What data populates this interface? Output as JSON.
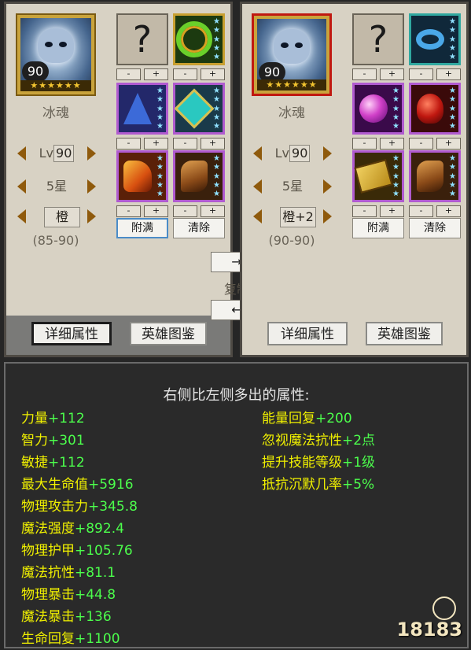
{
  "left": {
    "portrait": {
      "level": "90",
      "stars": "★★★★★★",
      "icon": "ice-soul-hero-icon"
    },
    "name": "冰魂",
    "level": {
      "prefix": "Lv",
      "value": "90"
    },
    "star_rank": "5星",
    "quality": "橙",
    "range": "(85-90)",
    "slots": [
      {
        "type": "empty",
        "icon": "question-mark-icon",
        "glyph": "?"
      },
      {
        "type": "item",
        "icon": "green-ring-icon"
      },
      {
        "type": "item",
        "icon": "wizard-hat-icon"
      },
      {
        "type": "item",
        "icon": "teal-amulet-icon"
      },
      {
        "type": "item",
        "icon": "fire-gauntlet-icon"
      },
      {
        "type": "item",
        "icon": "leather-boots-icon"
      }
    ],
    "fill_label": "附满",
    "clear_label": "清除",
    "detail_label": "详细属性",
    "codex_label": "英雄图鉴"
  },
  "right": {
    "portrait": {
      "level": "90",
      "stars": "★★★★★★",
      "icon": "ice-soul-hero-icon"
    },
    "name": "冰魂",
    "level": {
      "prefix": "Lv",
      "value": "90"
    },
    "star_rank": "5星",
    "quality": "橙+2",
    "range": "(90-90)",
    "slots": [
      {
        "type": "empty",
        "icon": "question-mark-icon",
        "glyph": "?"
      },
      {
        "type": "item",
        "icon": "blue-bracelet-icon"
      },
      {
        "type": "item",
        "icon": "magic-orb-icon"
      },
      {
        "type": "item",
        "icon": "red-beetle-icon"
      },
      {
        "type": "item",
        "icon": "spellbook-icon"
      },
      {
        "type": "item",
        "icon": "leather-boots-icon"
      }
    ],
    "fill_label": "附满",
    "clear_label": "清除",
    "detail_label": "详细属性",
    "codex_label": "英雄图鉴"
  },
  "stepper": {
    "minus": "-",
    "plus": "+"
  },
  "copy": {
    "right_arrow": "→",
    "label": "复制",
    "left_arrow": "←"
  },
  "diff": {
    "title": "右侧比左侧多出的属性:",
    "left_col": [
      {
        "name": "力量",
        "value": "+112"
      },
      {
        "name": "智力",
        "value": "+301"
      },
      {
        "name": "敏捷",
        "value": "+112"
      },
      {
        "name": "最大生命值",
        "value": "+5916"
      },
      {
        "name": "物理攻击力",
        "value": "+345.8"
      },
      {
        "name": "魔法强度",
        "value": "+892.4"
      },
      {
        "name": "物理护甲",
        "value": "+105.76"
      },
      {
        "name": "魔法抗性",
        "value": "+81.1"
      },
      {
        "name": "物理暴击",
        "value": "+44.8"
      },
      {
        "name": "魔法暴击",
        "value": "+136"
      },
      {
        "name": "生命回复",
        "value": "+1100"
      }
    ],
    "right_col": [
      {
        "name": "能量回复",
        "value": "+200"
      },
      {
        "name": "忽视魔法抗性",
        "value": "+2点"
      },
      {
        "name": "提升技能等级",
        "value": "+1级"
      },
      {
        "name": "抵抗沉默几率",
        "value": "+5%"
      }
    ]
  },
  "watermark": "18183",
  "colors": {
    "attr_name": "#f0f000",
    "attr_value": "#4cff4c",
    "panel_bg": "#d8d2c4",
    "diff_bg": "#2a2a2a"
  }
}
